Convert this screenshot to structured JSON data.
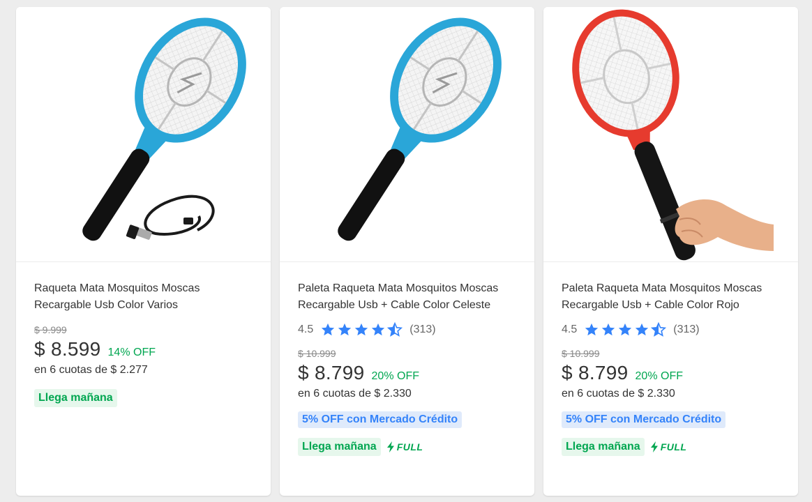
{
  "products": [
    {
      "title": "Raqueta Mata Mosquitos Moscas Recargable Usb Color Varios",
      "old_price": "$ 9.999",
      "price": "$ 8.599",
      "discount": "14% OFF",
      "installments": "en 6 cuotas de $ 2.277",
      "shipping": "Llega mañana",
      "racket_color": "#2aa6d8",
      "image_icon": "blue-racket-with-usb-cable"
    },
    {
      "title": "Paleta Raqueta Mata Mosquitos Moscas Recargable Usb + Cable Color Celeste",
      "rating": "4.5",
      "rating_value": 4.5,
      "reviews": "(313)",
      "old_price": "$ 10.999",
      "price": "$ 8.799",
      "discount": "20% OFF",
      "installments": "en 6 cuotas de $ 2.330",
      "promo": "5% OFF con Mercado Crédito",
      "shipping": "Llega mañana",
      "full_label": "FULL",
      "racket_color": "#2aa6d8",
      "image_icon": "blue-racket"
    },
    {
      "title": "Paleta Raqueta Mata Mosquitos Moscas Recargable Usb + Cable Color Rojo",
      "rating": "4.5",
      "rating_value": 4.5,
      "reviews": "(313)",
      "old_price": "$ 10.999",
      "price": "$ 8.799",
      "discount": "20% OFF",
      "installments": "en 6 cuotas de $ 2.330",
      "promo": "5% OFF con Mercado Crédito",
      "shipping": "Llega mañana",
      "full_label": "FULL",
      "racket_color": "#e63b2e",
      "image_icon": "red-racket-held-in-hand"
    }
  ],
  "colors": {
    "green": "#00a650",
    "blue": "#3483fa",
    "star": "#3483fa"
  }
}
